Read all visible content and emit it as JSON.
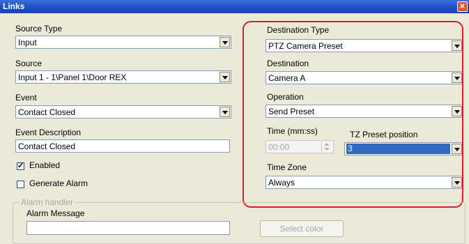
{
  "window": {
    "title": "Links",
    "close_icon": "close-icon"
  },
  "left": {
    "source_type": {
      "label": "Source Type",
      "value": "Input"
    },
    "source": {
      "label": "Source",
      "value": "Input 1 - 1\\Panel 1\\Door REX"
    },
    "event": {
      "label": "Event",
      "value": "Contact Closed"
    },
    "event_description": {
      "label": "Event Description",
      "value": "Contact Closed"
    },
    "enabled": {
      "label": "Enabled",
      "checked": true
    },
    "generate_alarm": {
      "label": "Generate Alarm",
      "checked": false
    }
  },
  "right": {
    "destination_type": {
      "label": "Destination Type",
      "value": "PTZ Camera Preset"
    },
    "destination": {
      "label": "Destination",
      "value": "Camera A"
    },
    "operation": {
      "label": "Operation",
      "value": "Send Preset"
    },
    "time": {
      "label": "Time (mm:ss)",
      "value": "00:00"
    },
    "preset_position": {
      "label": "TZ Preset position",
      "value": "3"
    },
    "time_zone": {
      "label": "Time Zone",
      "value": "Always"
    }
  },
  "alarm_handler": {
    "group_label": "Alarm handler",
    "message_label": "Alarm Message",
    "select_color_label": "Select color"
  },
  "colors": {
    "highlight_frame": "#d61f2a",
    "title_bar": "#1d4fc4",
    "selection": "#316ac5"
  }
}
